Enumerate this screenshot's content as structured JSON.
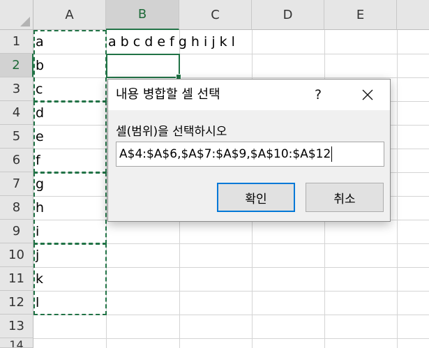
{
  "sheet": {
    "columns": [
      "A",
      "B",
      "C",
      "D",
      "E"
    ],
    "rows": [
      "1",
      "2",
      "3",
      "4",
      "5",
      "6",
      "7",
      "8",
      "9",
      "10",
      "11",
      "12",
      "13",
      "14"
    ],
    "cells": {
      "A1": "a",
      "B1": "a b c d e f g h i j k l",
      "A2": "b",
      "A3": "c",
      "A4": "d",
      "A5": "e",
      "A6": "f",
      "A7": "g",
      "A8": "h",
      "A9": "i",
      "A10": "j",
      "A11": "k",
      "A12": "l"
    },
    "active_cell": "B2",
    "selected_ranges": [
      "A1:A3",
      "A4:A6",
      "A7:A9",
      "A10:A12"
    ]
  },
  "dialog": {
    "title": "내용 병합할 셀 선택",
    "help_label": "?",
    "prompt": "셀(범위)을 선택하시오",
    "input_value": "A$4:$A$6,$A$7:$A$9,$A$10:$A$12",
    "ok_label": "확인",
    "cancel_label": "취소",
    "close_icon": "close-icon"
  },
  "colors": {
    "selection_green": "#217346",
    "header_gray": "#e6e6e6",
    "ok_border_blue": "#0078d7"
  }
}
